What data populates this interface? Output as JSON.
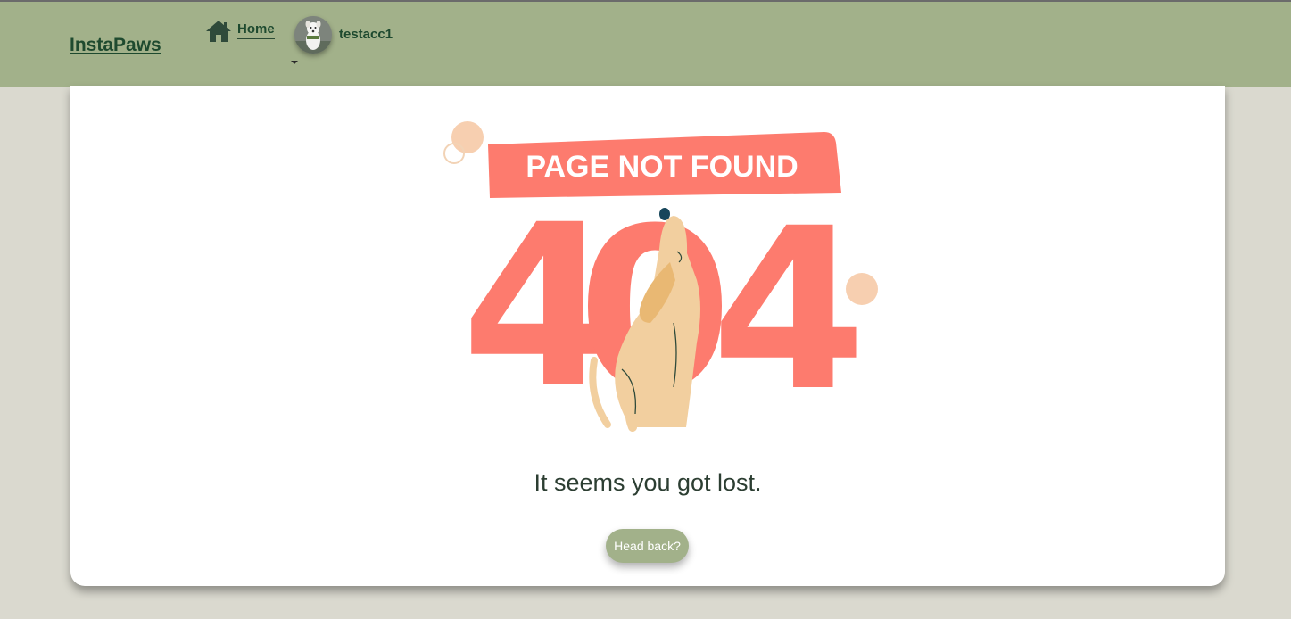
{
  "navbar": {
    "brand": "InstaPaws",
    "home_label": "Home",
    "home_icon": "house-icon",
    "username": "testacc1",
    "avatar": "dog-avatar"
  },
  "illustration": {
    "banner_text": "PAGE NOT FOUND",
    "code_left": "4",
    "code_middle": "0",
    "code_right": "4",
    "subject": "dog-howling-icon"
  },
  "main": {
    "message": "It seems you got lost.",
    "button_label": "Head back?"
  },
  "colors": {
    "navbar": "#a2b18a",
    "background": "#dad9cf",
    "text_dark_green": "#1e4a2f",
    "coral": "#fd7b6e",
    "dog": "#f2cf9f",
    "button": "#a2b18a"
  }
}
